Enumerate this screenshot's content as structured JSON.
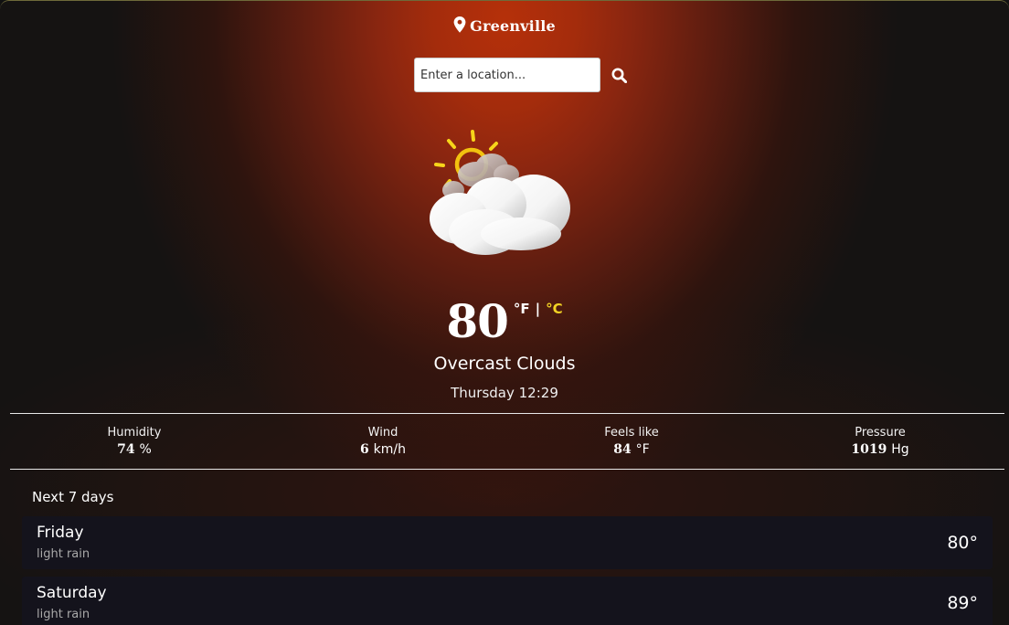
{
  "header": {
    "location_icon": "map-pin-icon",
    "city": "Greenville"
  },
  "search": {
    "placeholder": "Enter a location...",
    "value": "",
    "button_icon": "search-icon"
  },
  "current": {
    "icon": "partly-cloudy-icon",
    "temperature": "80",
    "unit_f": "°F",
    "unit_separator": "|",
    "unit_c": "°C",
    "condition": "Overcast Clouds",
    "datetime": "Thursday 12:29"
  },
  "stats": [
    {
      "label": "Humidity",
      "value": "74",
      "unit": "%"
    },
    {
      "label": "Wind",
      "value": "6",
      "unit": "km/h"
    },
    {
      "label": "Feels like",
      "value": "84",
      "unit": "°F"
    },
    {
      "label": "Pressure",
      "value": "1019",
      "unit": "Hg"
    }
  ],
  "forecast": {
    "title": "Next 7 days",
    "days": [
      {
        "day": "Friday",
        "description": "light rain",
        "temp": "80°"
      },
      {
        "day": "Saturday",
        "description": "light rain",
        "temp": "89°"
      }
    ]
  },
  "colors": {
    "accent_celsius": "#f2d324",
    "background_glow": "#b5300a",
    "row_background": "#14131c"
  }
}
